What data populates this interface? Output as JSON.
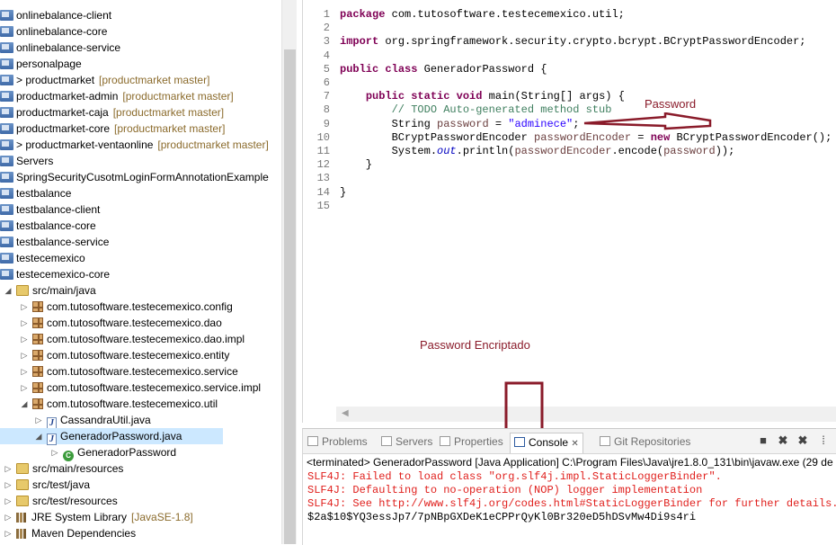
{
  "explorer": {
    "items": [
      {
        "label": "onlinebalance-client",
        "decoration": "",
        "level": 0,
        "twisty": "",
        "icon": "project-icon"
      },
      {
        "label": "onlinebalance-core",
        "decoration": "",
        "level": 0,
        "twisty": "",
        "icon": "project-icon"
      },
      {
        "label": "onlinebalance-service",
        "decoration": "",
        "level": 0,
        "twisty": "",
        "icon": "project-icon"
      },
      {
        "label": "personalpage",
        "decoration": "",
        "level": 0,
        "twisty": "",
        "icon": "project-icon"
      },
      {
        "label": "> productmarket",
        "decoration": "[productmarket master]",
        "level": 0,
        "twisty": "",
        "icon": "project-icon"
      },
      {
        "label": "productmarket-admin",
        "decoration": "[productmarket master]",
        "level": 0,
        "twisty": "",
        "icon": "project-icon"
      },
      {
        "label": "productmarket-caja",
        "decoration": "[productmarket master]",
        "level": 0,
        "twisty": "",
        "icon": "project-icon"
      },
      {
        "label": "productmarket-core",
        "decoration": "[productmarket master]",
        "level": 0,
        "twisty": "",
        "icon": "project-icon"
      },
      {
        "label": "> productmarket-ventaonline",
        "decoration": "[productmarket master]",
        "level": 0,
        "twisty": "",
        "icon": "project-icon"
      },
      {
        "label": "Servers",
        "decoration": "",
        "level": 0,
        "twisty": "",
        "icon": "project-icon"
      },
      {
        "label": "SpringSecurityCusotmLoginFormAnnotationExample",
        "decoration": "",
        "level": 0,
        "twisty": "",
        "icon": "project-icon"
      },
      {
        "label": "testbalance",
        "decoration": "",
        "level": 0,
        "twisty": "",
        "icon": "project-icon"
      },
      {
        "label": "testbalance-client",
        "decoration": "",
        "level": 0,
        "twisty": "",
        "icon": "project-icon"
      },
      {
        "label": "testbalance-core",
        "decoration": "",
        "level": 0,
        "twisty": "",
        "icon": "project-icon"
      },
      {
        "label": "testbalance-service",
        "decoration": "",
        "level": 0,
        "twisty": "",
        "icon": "project-icon"
      },
      {
        "label": "testecemexico",
        "decoration": "",
        "level": 0,
        "twisty": "",
        "icon": "project-icon"
      },
      {
        "label": "testecemexico-core",
        "decoration": "",
        "level": 0,
        "twisty": "",
        "icon": "project-icon"
      },
      {
        "label": "src/main/java",
        "decoration": "",
        "level": 1,
        "twisty": "◢",
        "icon": "source-folder-icon"
      },
      {
        "label": "com.tutosoftware.testecemexico.config",
        "decoration": "",
        "level": 2,
        "twisty": "▷",
        "icon": "package-icon"
      },
      {
        "label": "com.tutosoftware.testecemexico.dao",
        "decoration": "",
        "level": 2,
        "twisty": "▷",
        "icon": "package-icon"
      },
      {
        "label": "com.tutosoftware.testecemexico.dao.impl",
        "decoration": "",
        "level": 2,
        "twisty": "▷",
        "icon": "package-icon"
      },
      {
        "label": "com.tutosoftware.testecemexico.entity",
        "decoration": "",
        "level": 2,
        "twisty": "▷",
        "icon": "package-icon"
      },
      {
        "label": "com.tutosoftware.testecemexico.service",
        "decoration": "",
        "level": 2,
        "twisty": "▷",
        "icon": "package-icon"
      },
      {
        "label": "com.tutosoftware.testecemexico.service.impl",
        "decoration": "",
        "level": 2,
        "twisty": "▷",
        "icon": "package-icon"
      },
      {
        "label": "com.tutosoftware.testecemexico.util",
        "decoration": "",
        "level": 2,
        "twisty": "◢",
        "icon": "package-icon"
      },
      {
        "label": "CassandraUtil.java",
        "decoration": "",
        "level": 3,
        "twisty": "▷",
        "icon": "java-file-icon"
      },
      {
        "label": "GeneradorPassword.java",
        "decoration": "",
        "level": 3,
        "twisty": "◢",
        "icon": "java-file-icon"
      },
      {
        "label": "GeneradorPassword",
        "decoration": "",
        "level": 4,
        "twisty": "▷",
        "icon": "class-icon"
      },
      {
        "label": "src/main/resources",
        "decoration": "",
        "level": 1,
        "twisty": "▷",
        "icon": "source-folder-icon"
      },
      {
        "label": "src/test/java",
        "decoration": "",
        "level": 1,
        "twisty": "▷",
        "icon": "source-folder-icon"
      },
      {
        "label": "src/test/resources",
        "decoration": "",
        "level": 1,
        "twisty": "▷",
        "icon": "source-folder-icon"
      },
      {
        "label": "JRE System Library",
        "decoration": "[JavaSE-1.8]",
        "level": 1,
        "twisty": "▷",
        "icon": "library-icon"
      },
      {
        "label": "Maven Dependencies",
        "decoration": "",
        "level": 1,
        "twisty": "▷",
        "icon": "library-icon"
      }
    ],
    "selected_index": 26
  },
  "editor": {
    "line_numbers": [
      "1",
      "2",
      "3",
      "4",
      "5",
      "6",
      "7",
      "8",
      "9",
      "10",
      "11",
      "12",
      "13",
      "14",
      "15"
    ],
    "lines": [
      [
        {
          "t": "package",
          "c": "kw"
        },
        {
          "t": " com.tutosoftware.testecemexico.util;",
          "c": ""
        }
      ],
      [],
      [
        {
          "t": "import",
          "c": "kw"
        },
        {
          "t": " org.springframework.security.crypto.bcrypt.BCryptPasswordEncoder;",
          "c": ""
        }
      ],
      [],
      [
        {
          "t": "public",
          "c": "kw"
        },
        {
          "t": " ",
          "c": ""
        },
        {
          "t": "class",
          "c": "kw"
        },
        {
          "t": " GeneradorPassword {",
          "c": ""
        }
      ],
      [],
      [
        {
          "t": "    ",
          "c": ""
        },
        {
          "t": "public",
          "c": "kw"
        },
        {
          "t": " ",
          "c": ""
        },
        {
          "t": "static",
          "c": "kw"
        },
        {
          "t": " ",
          "c": ""
        },
        {
          "t": "void",
          "c": "kw"
        },
        {
          "t": " main(String[] args) {",
          "c": ""
        }
      ],
      [
        {
          "t": "        // TODO Auto-generated method stub",
          "c": "cm"
        }
      ],
      [
        {
          "t": "        String ",
          "c": ""
        },
        {
          "t": "password",
          "c": "var"
        },
        {
          "t": " = ",
          "c": ""
        },
        {
          "t": "\"adminece\"",
          "c": "st"
        },
        {
          "t": ";",
          "c": ""
        }
      ],
      [
        {
          "t": "        BCryptPasswordEncoder ",
          "c": ""
        },
        {
          "t": "passwordEncoder",
          "c": "var"
        },
        {
          "t": " = ",
          "c": ""
        },
        {
          "t": "new",
          "c": "kw"
        },
        {
          "t": " BCryptPasswordEncoder();",
          "c": ""
        }
      ],
      [
        {
          "t": "        System.",
          "c": ""
        },
        {
          "t": "out",
          "c": "fld"
        },
        {
          "t": ".println(",
          "c": ""
        },
        {
          "t": "passwordEncoder",
          "c": "var"
        },
        {
          "t": ".encode(",
          "c": ""
        },
        {
          "t": "password",
          "c": "var"
        },
        {
          "t": "));",
          "c": ""
        }
      ],
      [
        {
          "t": "    }",
          "c": ""
        }
      ],
      [],
      [
        {
          "t": "}",
          "c": ""
        }
      ],
      []
    ]
  },
  "annotations": {
    "password_label": "Password",
    "encrypted_label": "Password Encriptado",
    "color": "#8a1b2a"
  },
  "console": {
    "tabs": [
      {
        "label": "Problems",
        "icon": "problems-icon"
      },
      {
        "label": "Servers",
        "icon": "servers-icon"
      },
      {
        "label": "Properties",
        "icon": "properties-icon"
      },
      {
        "label": "Console",
        "icon": "console-icon",
        "active": true
      },
      {
        "label": "Git Repositories",
        "icon": "git-icon"
      }
    ],
    "close_glyph": "✕",
    "status": "<terminated> GeneradorPassword [Java Application] C:\\Program Files\\Java\\jre1.8.0_131\\bin\\javaw.exe (29 de ag",
    "lines": [
      {
        "text": "SLF4J: Failed to load class \"org.slf4j.impl.StaticLoggerBinder\".",
        "type": "err"
      },
      {
        "text": "SLF4J: Defaulting to no-operation (NOP) logger implementation",
        "type": "err"
      },
      {
        "text": "SLF4J: See http://www.slf4j.org/codes.html#StaticLoggerBinder for further details.",
        "type": "err"
      },
      {
        "text": "$2a$10$YQ3essJp7/7pNBpGXDeK1eCPPrQyKl0Br320eD5hDSvMw4Di9s4ri",
        "type": "out"
      }
    ],
    "toolbar": [
      "stop-icon",
      "remove-icon",
      "remove-all-icon",
      "more-icon"
    ]
  }
}
